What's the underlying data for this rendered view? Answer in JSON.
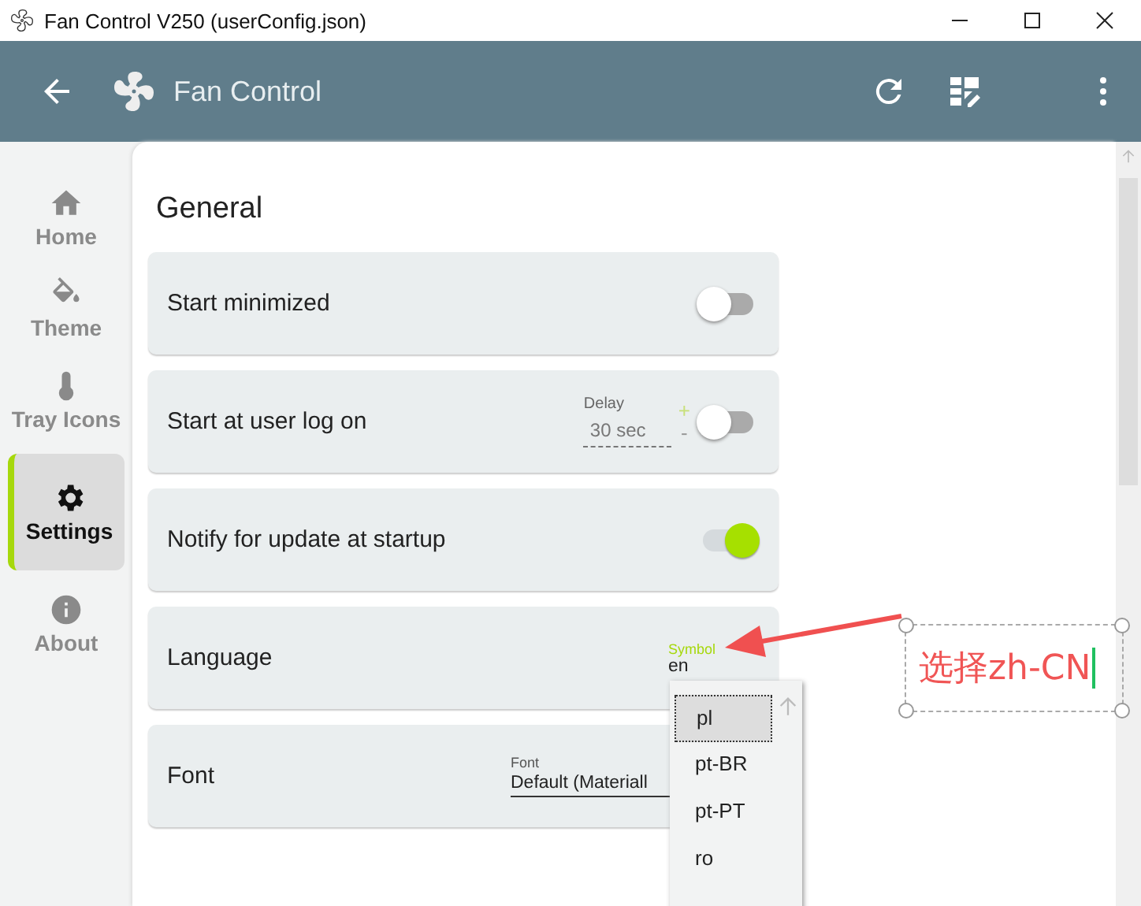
{
  "window": {
    "title": "Fan Control V250 (userConfig.json)"
  },
  "app_bar": {
    "title": "Fan Control"
  },
  "sidebar": {
    "items": [
      {
        "label": "Home",
        "selected": false
      },
      {
        "label": "Theme",
        "selected": false
      },
      {
        "label": "Tray Icons",
        "selected": false
      },
      {
        "label": "Settings",
        "selected": true
      },
      {
        "label": "About",
        "selected": false
      }
    ]
  },
  "section": {
    "title": "General"
  },
  "settings": [
    {
      "kind": "toggle",
      "label": "Start minimized",
      "on": false
    },
    {
      "kind": "toggle_delay",
      "label": "Start at user log on",
      "on": false,
      "delay": {
        "label": "Delay",
        "value": "30 sec",
        "plus": "+",
        "minus": "-"
      }
    },
    {
      "kind": "toggle",
      "label": "Notify for update at startup",
      "on": true
    },
    {
      "kind": "dropdown",
      "label": "Language",
      "field_label": "Symbol",
      "value": "en",
      "open": true,
      "options": [
        {
          "label": "pl",
          "selected": true
        },
        {
          "label": "pt-BR",
          "selected": false
        },
        {
          "label": "pt-PT",
          "selected": false
        },
        {
          "label": "ro",
          "selected": false
        }
      ]
    },
    {
      "kind": "dropdown",
      "label": "Font",
      "field_label": "Font",
      "value": "Default (Materiall",
      "open": false
    }
  ],
  "annotation": {
    "text": "选择zh-CN"
  }
}
